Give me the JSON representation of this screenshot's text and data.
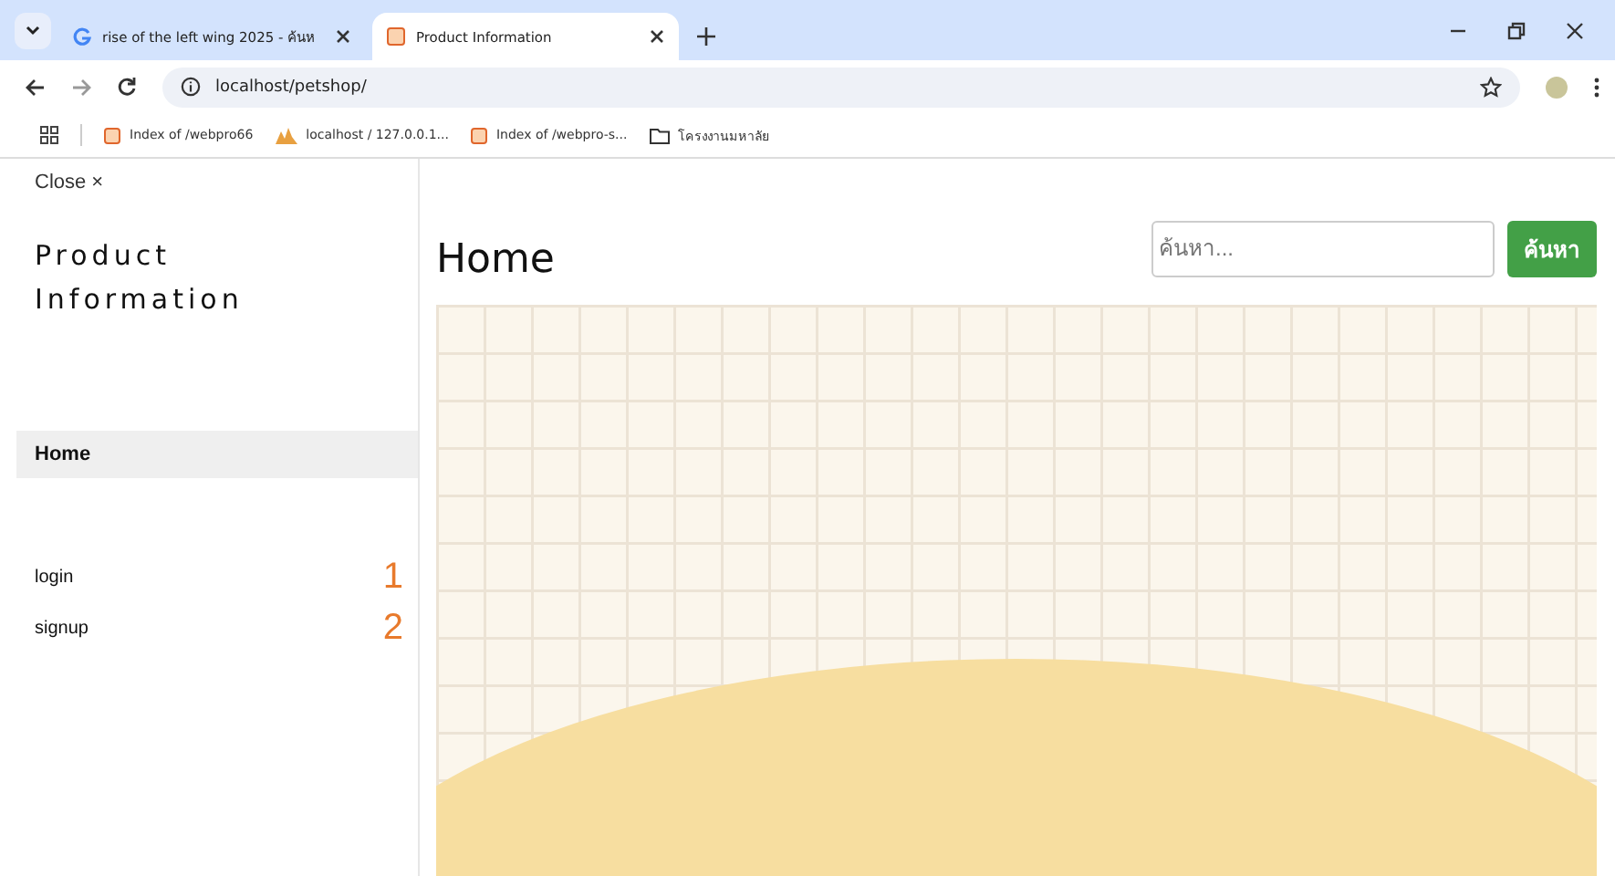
{
  "browser": {
    "tabs": [
      {
        "title": "rise of the left wing 2025 - ค้นห",
        "selected": false
      },
      {
        "title": "Product Information",
        "selected": true
      }
    ],
    "address": "localhost/petshop/",
    "bookmarks": [
      {
        "label": "Index of /webpro66"
      },
      {
        "label": "localhost / 127.0.0.1..."
      },
      {
        "label": "Index of /webpro-s..."
      },
      {
        "label": "โครงงานมหาลัย"
      }
    ]
  },
  "sidebar": {
    "close": "Close ×",
    "title": "Product Information",
    "items": [
      {
        "label": "Home",
        "selected": true
      }
    ],
    "links": [
      {
        "label": "login",
        "annotation": "1"
      },
      {
        "label": "signup",
        "annotation": "2"
      }
    ]
  },
  "main": {
    "heading": "Home",
    "search": {
      "placeholder": "ค้นหา...",
      "button": "ค้นหา"
    }
  }
}
